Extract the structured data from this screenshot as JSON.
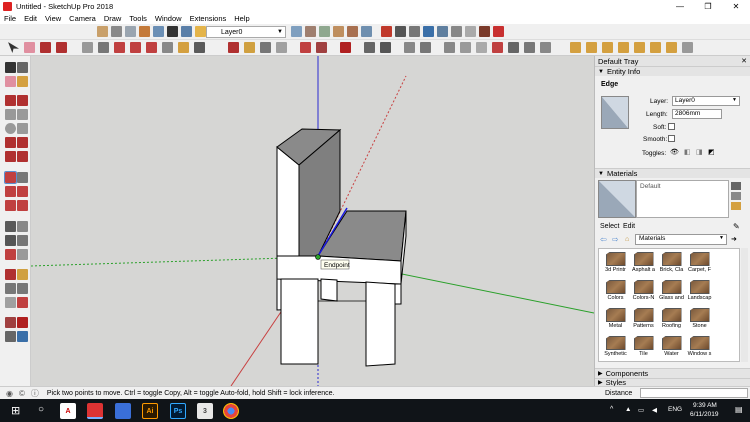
{
  "window": {
    "title": "Untitled - SketchUp Pro 2018",
    "min": "—",
    "max": "❐",
    "close": "✕"
  },
  "menu": [
    "File",
    "Edit",
    "View",
    "Camera",
    "Draw",
    "Tools",
    "Window",
    "Extensions",
    "Help"
  ],
  "toolbar": {
    "layer_value": "Layer0"
  },
  "viewport": {
    "inference_tooltip": "Endpoint"
  },
  "tray": {
    "title": "Default Tray",
    "close": "✕",
    "entity_info": {
      "header": "Entity Info",
      "entity_type": "Edge",
      "layer_label": "Layer:",
      "layer_value": "Layer0",
      "length_label": "Length:",
      "length_value": "2806mm",
      "soft_label": "Soft:",
      "smooth_label": "Smooth:",
      "toggles_label": "Toggles:"
    },
    "materials": {
      "header": "Materials",
      "current": "Default",
      "tab_select": "Select",
      "tab_edit": "Edit",
      "library": "Materials",
      "items": [
        "3d Printr",
        "Asphalt a",
        "Brick, Cla",
        "Carpet, F",
        "Colors",
        "Colors-N",
        "Glass and",
        "Landscap",
        "Metal",
        "Patterns",
        "Roofing",
        "Stone",
        "Synthetic",
        "Tile",
        "Water",
        "Window s"
      ]
    },
    "components": {
      "header": "Components"
    },
    "styles": {
      "header": "Styles"
    }
  },
  "status": {
    "message": "Pick two points to move.  Ctrl = toggle Copy, Alt = toggle Auto-fold, hold Shift = lock inference.",
    "measurement_label": "Distance"
  },
  "taskbar": {
    "apps": [
      "A",
      "",
      "Ai",
      "Ps",
      "3",
      ""
    ],
    "lang": "ENG",
    "time": "9:39 AM",
    "date": "6/11/2019"
  }
}
